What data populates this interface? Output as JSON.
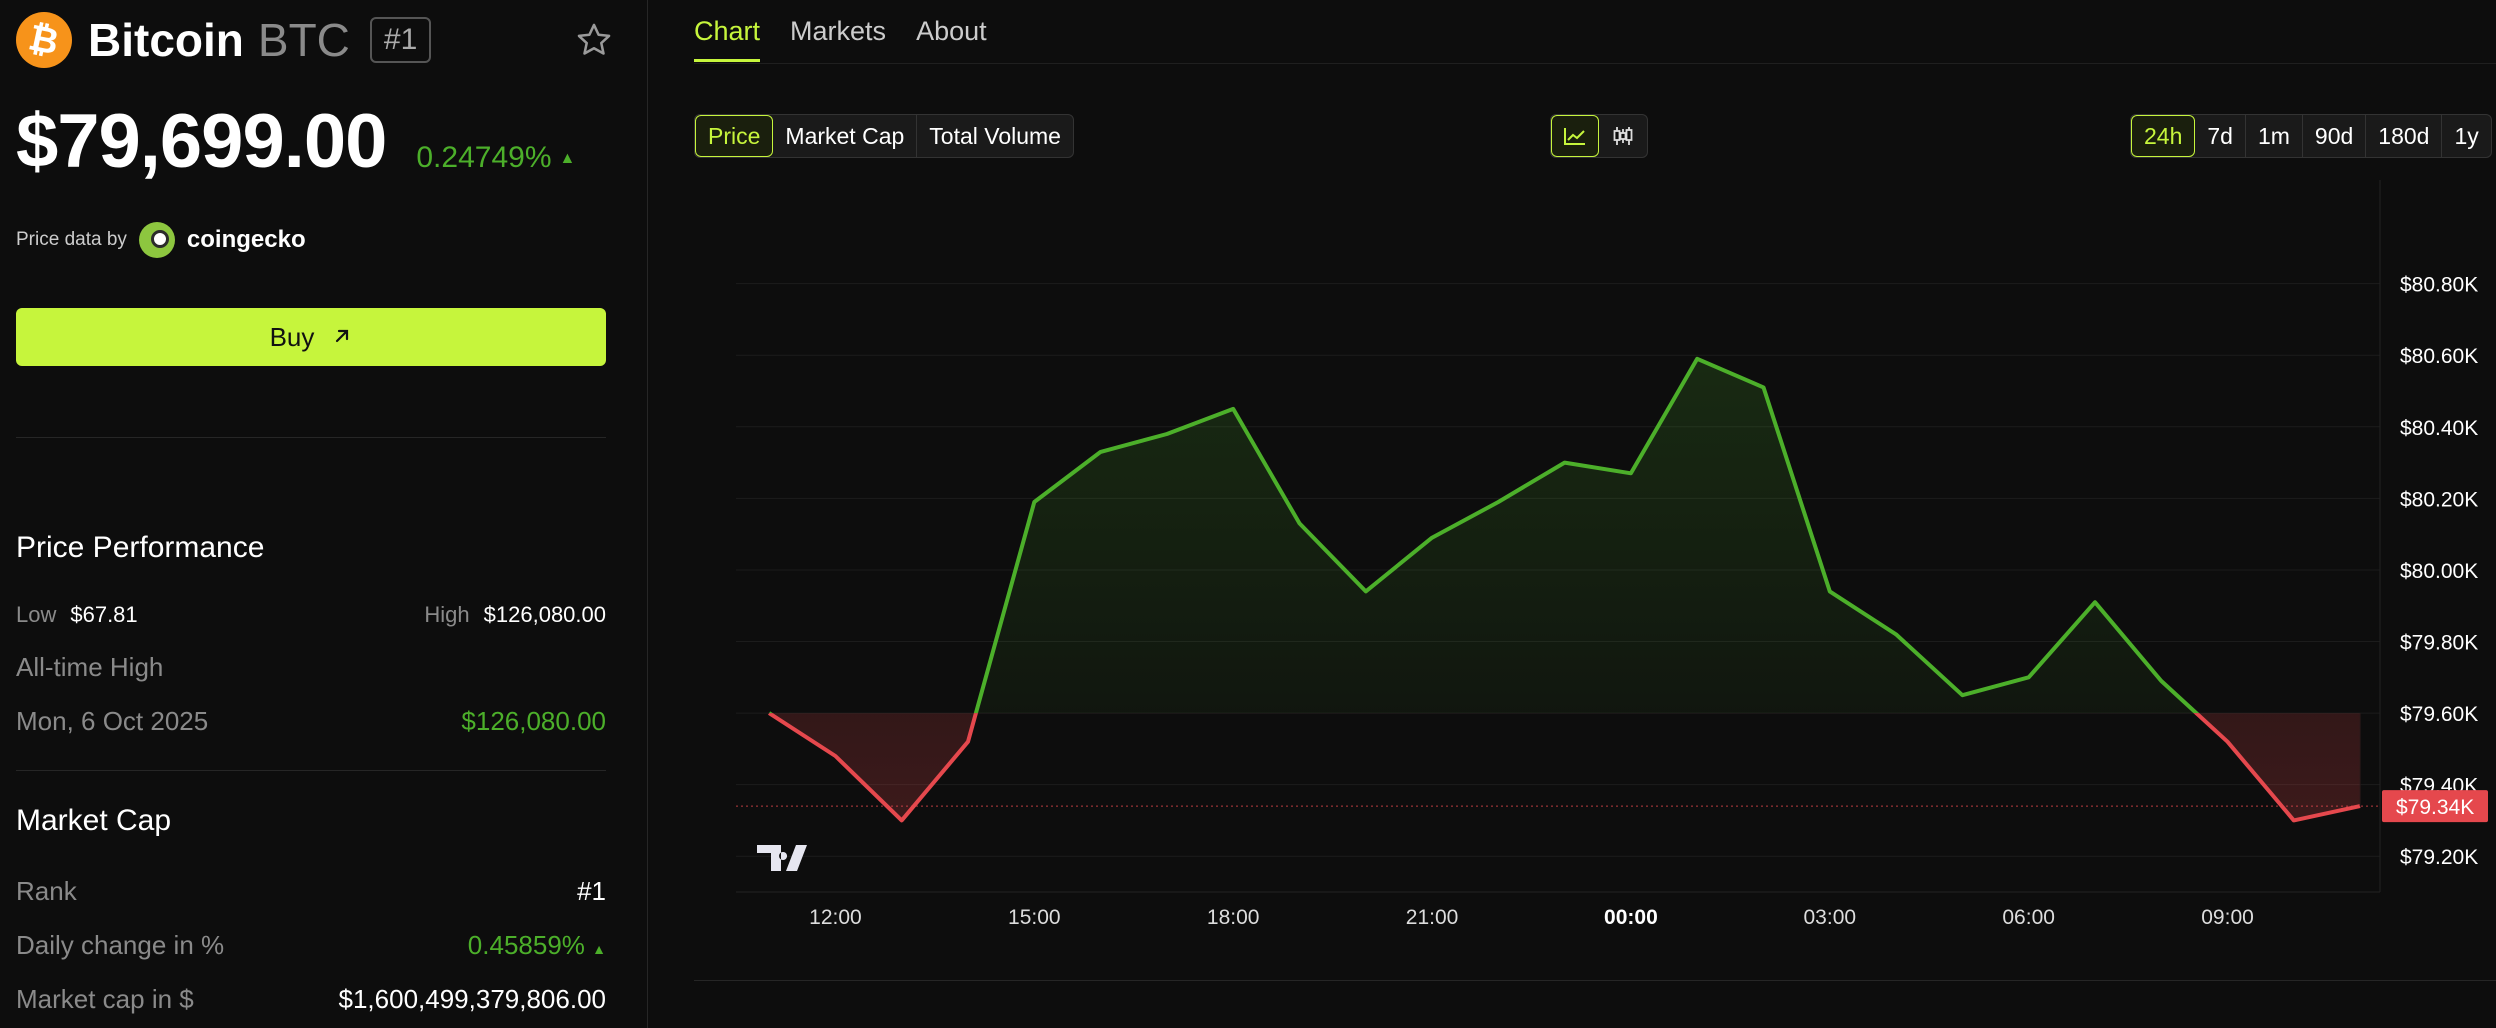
{
  "coin": {
    "icon": "bitcoin-icon",
    "name": "Bitcoin",
    "symbol": "BTC",
    "rank": "#1",
    "price": "$79,699.00",
    "change": "0.24749%",
    "change_arrow": "▲"
  },
  "price_data": {
    "label": "Price data by",
    "provider": "coingecko"
  },
  "buy": {
    "label": "Buy",
    "icon": "external-arrow-icon"
  },
  "performance": {
    "title": "Price Performance",
    "low_label": "Low",
    "low_value": "$67.81",
    "high_label": "High",
    "high_value": "$126,080.00",
    "ath_label": "All-time High",
    "ath_date": "Mon, 6 Oct 2025",
    "ath_value": "$126,080.00"
  },
  "market_cap": {
    "title": "Market Cap",
    "rank_label": "Rank",
    "rank_value": "#1",
    "daily_label": "Daily change in %",
    "daily_value": "0.45859%",
    "daily_arrow": "▲",
    "cap_label": "Market cap in $",
    "cap_value": "$1,600,499,379,806.00"
  },
  "tabs": [
    {
      "label": "Chart",
      "active": true
    },
    {
      "label": "Markets",
      "active": false
    },
    {
      "label": "About",
      "active": false
    }
  ],
  "metric_buttons": [
    {
      "label": "Price",
      "active": true
    },
    {
      "label": "Market Cap",
      "active": false
    },
    {
      "label": "Total Volume",
      "active": false
    }
  ],
  "chart_style_buttons": [
    {
      "icon": "line-chart-icon",
      "active": true
    },
    {
      "icon": "candlestick-icon",
      "active": false
    }
  ],
  "range_buttons": [
    {
      "label": "24h",
      "active": true
    },
    {
      "label": "7d",
      "active": false
    },
    {
      "label": "1m",
      "active": false
    },
    {
      "label": "90d",
      "active": false
    },
    {
      "label": "180d",
      "active": false
    },
    {
      "label": "1y",
      "active": false
    }
  ],
  "colors": {
    "accent": "#c6f53c",
    "up": "#4caf2a",
    "down": "#e5484d",
    "bitcoin": "#f7931a"
  },
  "chart_data": {
    "type": "line",
    "baseline": 79600,
    "current_price_label": "$79.34K",
    "current_price": 79340,
    "x_ticks": [
      "12:00",
      "15:00",
      "18:00",
      "21:00",
      "00:00",
      "03:00",
      "06:00",
      "09:00"
    ],
    "x_tick_hours": [
      12,
      15,
      18,
      21,
      24,
      27,
      30,
      33
    ],
    "y_ticks": [
      "$80.80K",
      "$80.60K",
      "$80.40K",
      "$80.20K",
      "$80.00K",
      "$79.80K",
      "$79.60K",
      "$79.40K",
      "$79.20K"
    ],
    "y_tick_values": [
      80800,
      80600,
      80400,
      80200,
      80000,
      79800,
      79600,
      79400,
      79200
    ],
    "ylim": [
      79100,
      80950
    ],
    "xlim": [
      10.5,
      35.3
    ],
    "x_hours": [
      11,
      12,
      13,
      14,
      15,
      16,
      17,
      18,
      19,
      20,
      21,
      22,
      23,
      24,
      25,
      26,
      27,
      28,
      29,
      30,
      31,
      32,
      33,
      34,
      35
    ],
    "values": [
      79600,
      79480,
      79300,
      79520,
      80190,
      80330,
      80380,
      80450,
      80130,
      79940,
      80090,
      80190,
      80300,
      80270,
      80590,
      80510,
      79940,
      79820,
      79650,
      79700,
      79910,
      79690,
      79520,
      79300,
      79340
    ]
  }
}
